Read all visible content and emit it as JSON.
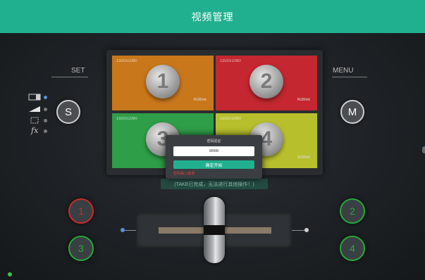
{
  "header": {
    "title": "视频管理"
  },
  "left_panel": {
    "label": "SET",
    "button": "S"
  },
  "right_panel": {
    "label": "MENU",
    "button": "M"
  },
  "quadrants": [
    {
      "res": "1920x1080",
      "num": "1",
      "color": "#c9771b",
      "tag": "RGBlink"
    },
    {
      "res": "1920x1080",
      "num": "2",
      "color": "#c4272f",
      "tag": "RGBlink"
    },
    {
      "res": "1920x1080",
      "num": "3",
      "color": "#2f9e48",
      "tag": ""
    },
    {
      "res": "1920x1080",
      "num": "4",
      "color": "#b7bf2c",
      "tag": "RGBlink"
    }
  ],
  "notice": "(TAKE已完成，无法进行其他操作！)",
  "dialog": {
    "title": "密码验证",
    "input_value": "8888",
    "button": "确定开始",
    "error": "密码输入错误"
  },
  "left_buttons": [
    "1",
    "3"
  ],
  "right_buttons": [
    "2",
    "4"
  ]
}
